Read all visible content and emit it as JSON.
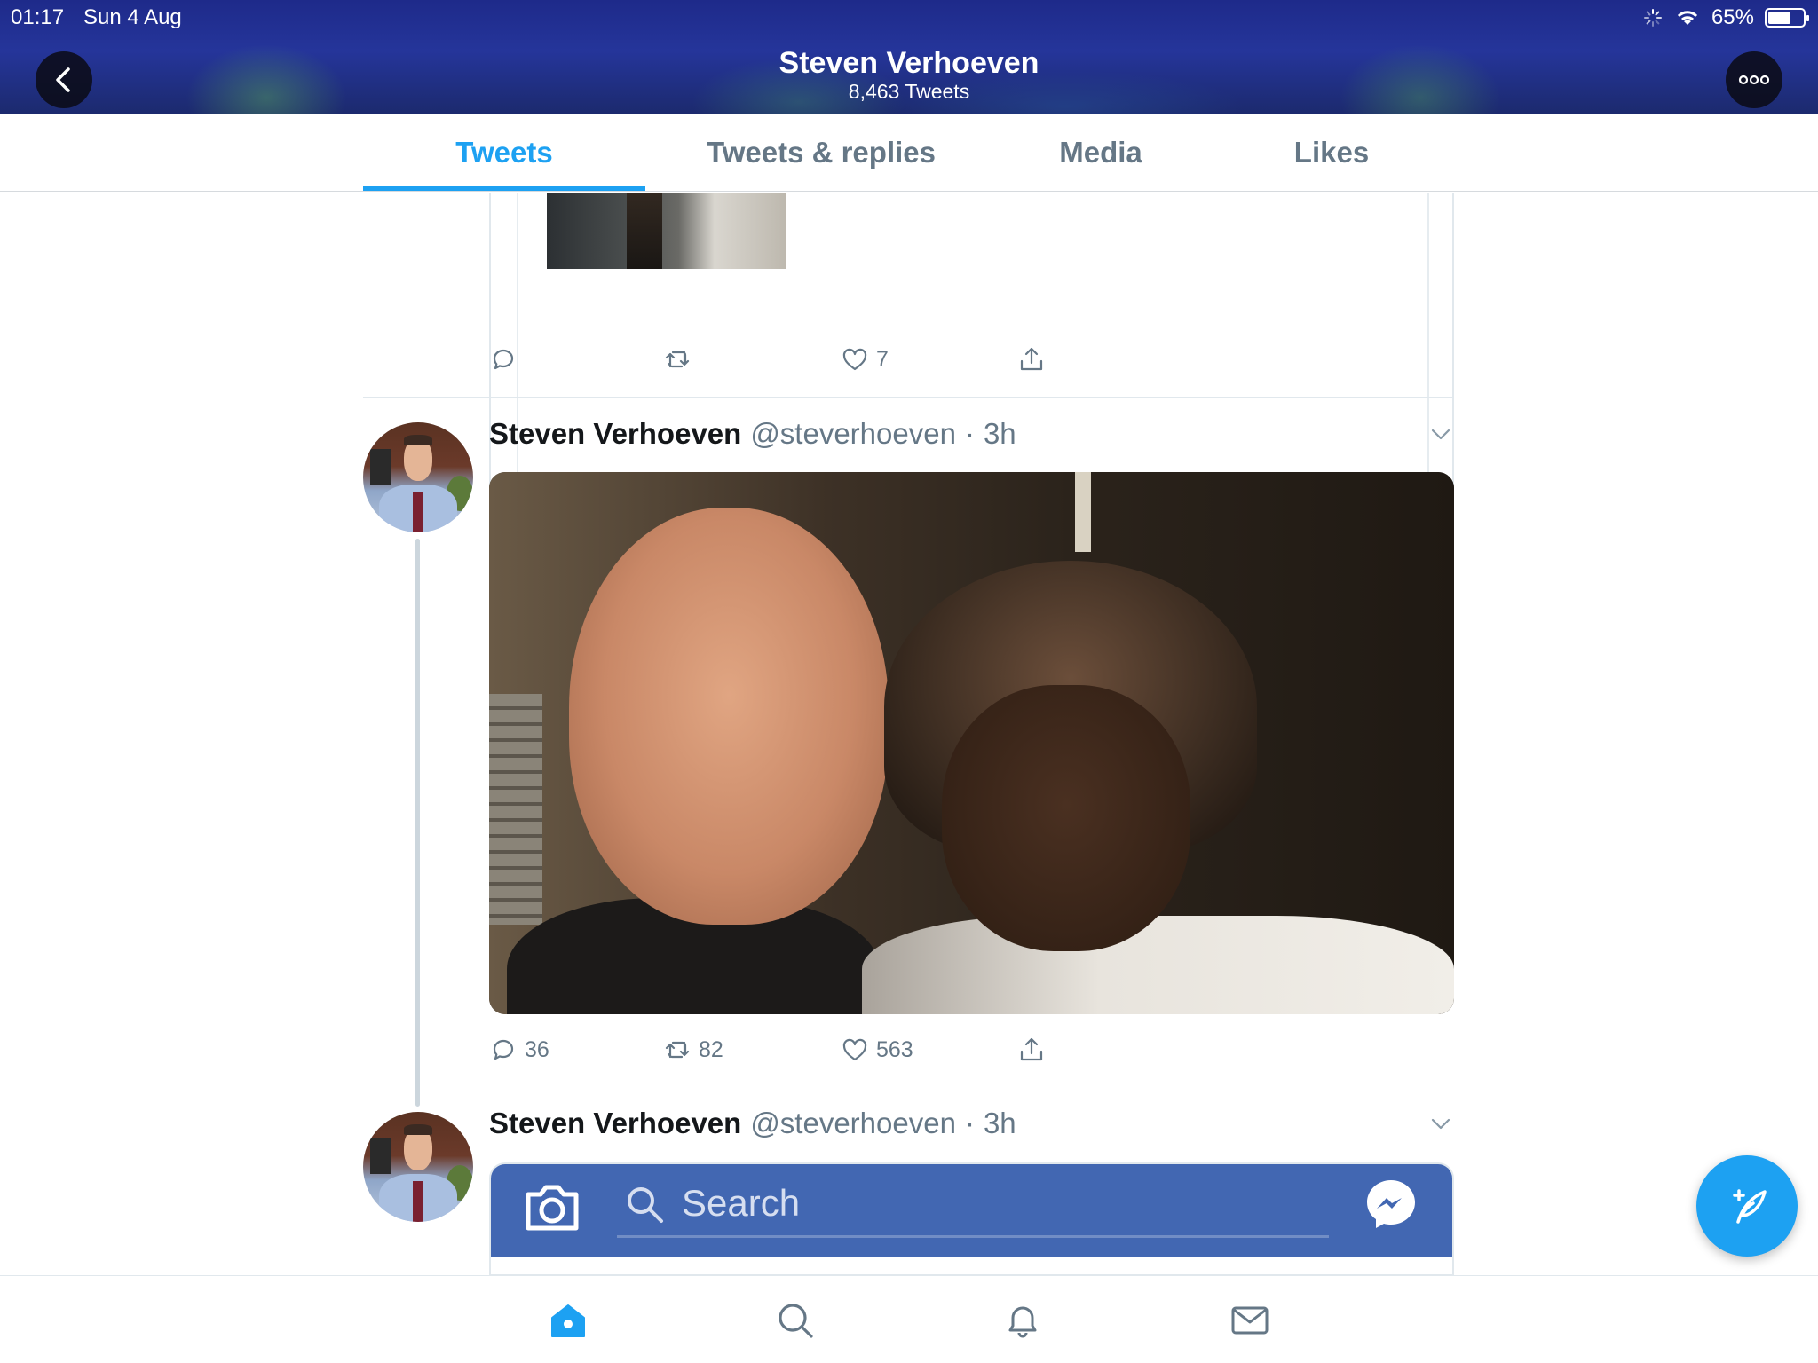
{
  "status_bar": {
    "time": "01:17",
    "date": "Sun 4 Aug",
    "battery": "65%",
    "battery_level": 0.65
  },
  "header": {
    "title": "Steven Verhoeven",
    "subtitle": "8,463 Tweets"
  },
  "tabs": [
    {
      "label": "Tweets",
      "active": true
    },
    {
      "label": "Tweets & replies",
      "active": false
    },
    {
      "label": "Media",
      "active": false
    },
    {
      "label": "Likes",
      "active": false
    }
  ],
  "quoted_tweet_actions": {
    "replies": "",
    "retweets": "",
    "likes": "7"
  },
  "tweets": [
    {
      "name": "Steven Verhoeven",
      "handle": "@steverhoeven",
      "time": "3h",
      "actions": {
        "replies": "36",
        "retweets": "82",
        "likes": "563"
      }
    },
    {
      "name": "Steven Verhoeven",
      "handle": "@steverhoeven",
      "time": "3h",
      "embedded_search_placeholder": "Search"
    }
  ],
  "colors": {
    "accent": "#1da1f2",
    "text_secondary": "#657786",
    "facebook_blue": "#4267b2"
  },
  "icons": [
    "back-arrow-icon",
    "more-icon",
    "reply-icon",
    "retweet-icon",
    "like-icon",
    "share-icon",
    "chevron-down-icon",
    "camera-icon",
    "search-icon",
    "messenger-icon",
    "compose-icon",
    "home-icon",
    "notifications-icon",
    "messages-icon"
  ]
}
